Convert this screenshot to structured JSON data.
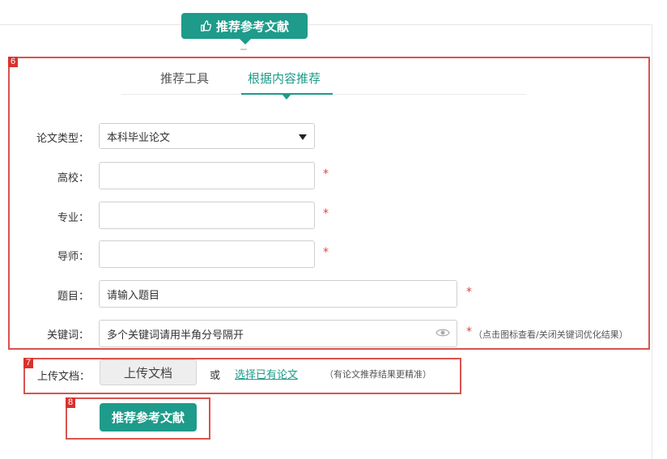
{
  "header": {
    "title": "推荐参考文献",
    "icon": "thumbs-up-icon"
  },
  "tabs": [
    {
      "label": "推荐工具",
      "active": false
    },
    {
      "label": "根据内容推荐",
      "active": true
    }
  ],
  "annotations": {
    "box6": "6",
    "box7": "7",
    "box8": "8"
  },
  "form": {
    "paper_type": {
      "label": "论文类型：",
      "value": "本科毕业论文"
    },
    "school": {
      "label": "高校：",
      "value": "",
      "required": "*"
    },
    "major": {
      "label": "专业：",
      "value": "",
      "required": "*"
    },
    "advisor": {
      "label": "导师：",
      "value": "",
      "required": "*"
    },
    "topic": {
      "label": "题目：",
      "placeholder": "请输入题目",
      "required": "*"
    },
    "keywords": {
      "label": "关键词：",
      "placeholder": "多个关键词请用半角分号隔开",
      "required": "*",
      "hint": "（点击图标查看/关闭关键词优化结果）",
      "icon": "eye-icon"
    }
  },
  "upload": {
    "label": "上传文档：",
    "button": "上传文档",
    "or_text": "或",
    "select_link": "选择已有论文",
    "hint": "（有论文推荐结果更精准）"
  },
  "submit": {
    "label": "推荐参考文献"
  },
  "colors": {
    "accent": "#1e9b8a",
    "annotation": "#d9322c",
    "required": "#e0443e"
  }
}
